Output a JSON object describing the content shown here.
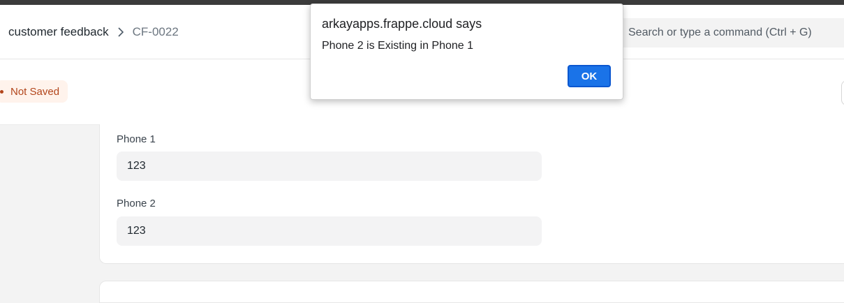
{
  "navbar": {
    "breadcrumb": {
      "parent": "customer feedback",
      "current": "CF-0022"
    },
    "search": {
      "placeholder": "Search or type a command (Ctrl + G)"
    }
  },
  "page_head": {
    "status_badge": "Not Saved",
    "status_color": "#b2451b"
  },
  "form": {
    "fields": [
      {
        "label": "Phone 1",
        "value": "123"
      },
      {
        "label": "Phone 2",
        "value": "123"
      }
    ]
  },
  "dialog": {
    "title": "arkayapps.frappe.cloud says",
    "message": "Phone 2 is Existing in Phone 1",
    "ok_label": "OK",
    "accent": "#1a73e8"
  },
  "icons": {
    "breadcrumb_separator": "chevron-right-icon"
  }
}
